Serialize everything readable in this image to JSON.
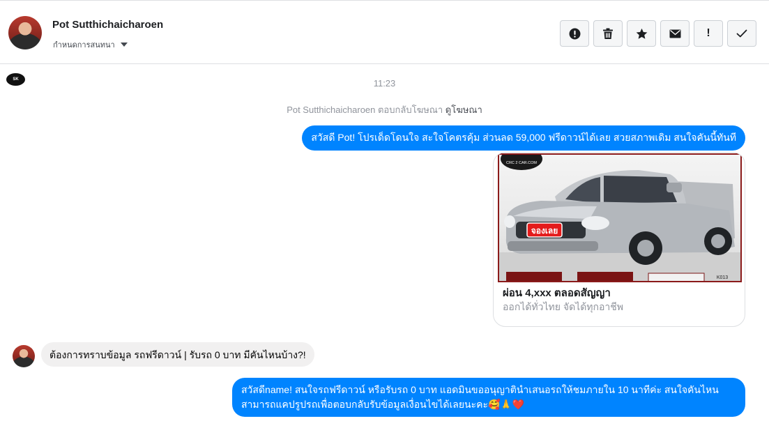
{
  "header": {
    "contact_name": "Pot Sutthichaicharoen",
    "conversation_label": "กำหนดการสนทนา"
  },
  "toolbar": {
    "buttons": [
      {
        "icon": "alert-circle-icon"
      },
      {
        "icon": "trash-icon"
      },
      {
        "icon": "star-icon"
      },
      {
        "icon": "envelope-icon"
      },
      {
        "icon": "exclamation-icon",
        "label": "!"
      },
      {
        "icon": "check-icon"
      }
    ]
  },
  "thread": {
    "time": "11:23",
    "reply_note": "Pot Sutthichaicharoen ตอบกลับโฆษณา",
    "reply_link": "ดูโฆษณา",
    "messages": [
      {
        "direction": "out",
        "text": "สวัสดี Pot! โปรเด็ดโดนใจ สะใจโคตรคุ้ม ส่วนลด 59,000 ฟรีดาวน์ได้เลย สวยสภาพเดิม สนใจคันนี้ทันที"
      },
      {
        "direction": "in",
        "text": "ต้องการทราบข้อมูล รถฟรีดาวน์ | รับรถ 0 บาท มีคันไหนบ้าง?!"
      },
      {
        "direction": "out",
        "text": "สวัสดีname! สนใจรถฟรีดาวน์ หรือรับรถ 0 บาท แอดมินขออนุญาตินำเสนอรถให้ชมภายใน 10 นาทีค่ะ สนใจคันไหนสามารถแคปรูปรถเพื่อตอบกลับรับข้อมูลเงื่อนไขได้เลยนะคะ🥰🙏❤️"
      }
    ]
  },
  "ad": {
    "badge": "จองเลย",
    "logo_text": "CRC 2 CAR.COM",
    "plate_code": "K013",
    "title": "ผ่อน 4,xxx ตลอดสัญญา",
    "subtitle": "ออกได้ทั่วไทย จัดได้ทุกอาชีพ"
  },
  "colors": {
    "accent": "#0084ff",
    "incoming_bubble": "#f1f0f0",
    "border": "#dddfe2"
  }
}
